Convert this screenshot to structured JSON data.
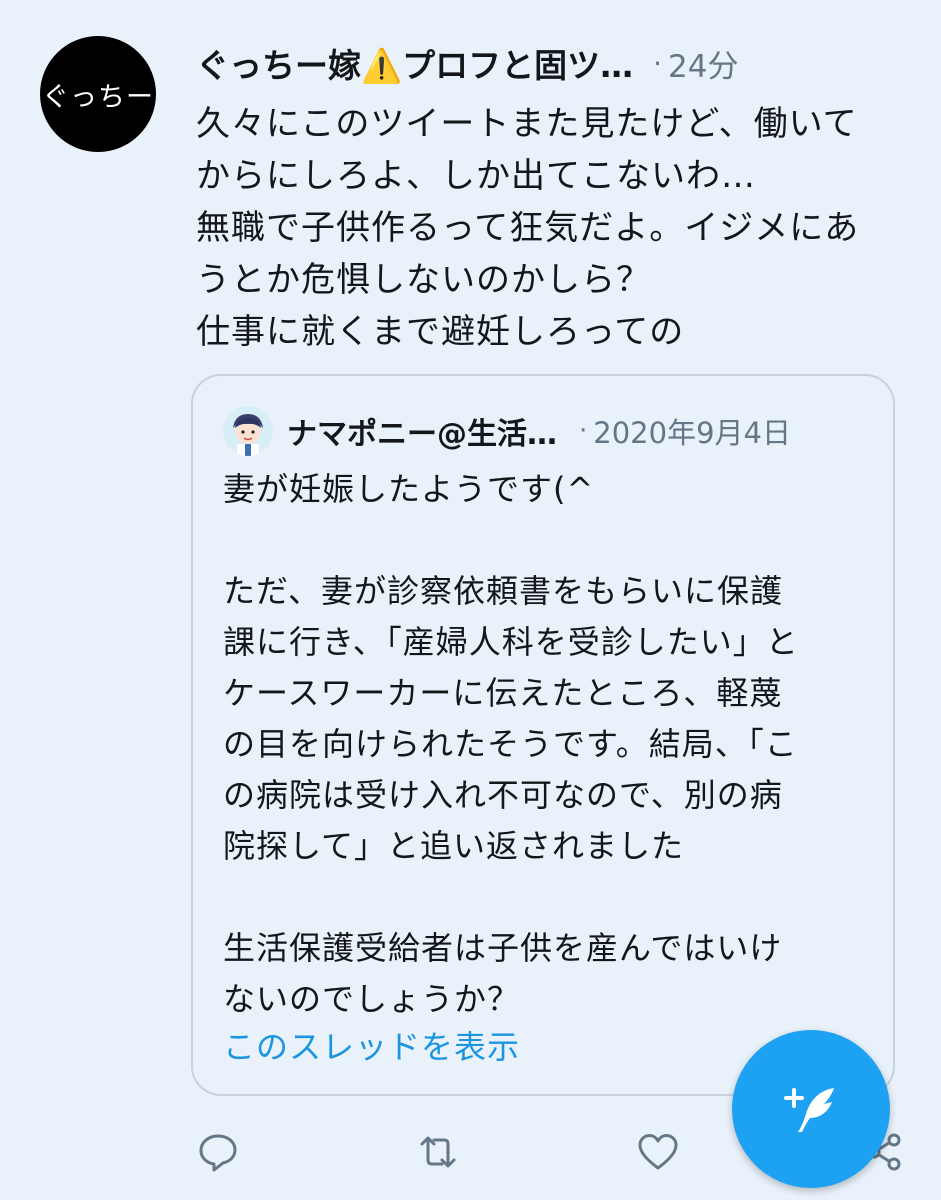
{
  "accent_color": "#1da1f2",
  "tweet": {
    "avatar_text": "ぐっちー",
    "display_name": "ぐっちー嫁⚠️プロフと固ツ…",
    "separator": "·",
    "time": "24分",
    "text": "久々にこのツイートまた見たけど、働いて\nからにしろよ、しか出てこないわ…\n無職で子供作るって狂気だよ。イジメにあ\nうとか危惧しないのかしら？\n仕事に就くまで避妊しろっての"
  },
  "quoted_tweet": {
    "display_name": "ナマポニー@生活…",
    "separator": "·",
    "date": "2020年9月4日",
    "text": "妻が妊娠したようです(^\n\nただ、妻が診察依頼書をもらいに保護\n課に行き、「産婦人科を受診したい」と\nケースワーカーに伝えたところ、軽蔑\nの目を向けられたそうです。結局、「こ\nの病院は受け入れ不可なので、別の病\n院探して」と追い返されました\n\n生活保護受給者は子供を産んではいけ\nないのでしょうか？",
    "show_thread_label": "このスレッドを表示"
  },
  "actions": {
    "icons": [
      "reply-icon",
      "retweet-icon",
      "like-icon",
      "share-icon"
    ]
  },
  "compose_button": {
    "icon": "compose-tweet-icon"
  }
}
